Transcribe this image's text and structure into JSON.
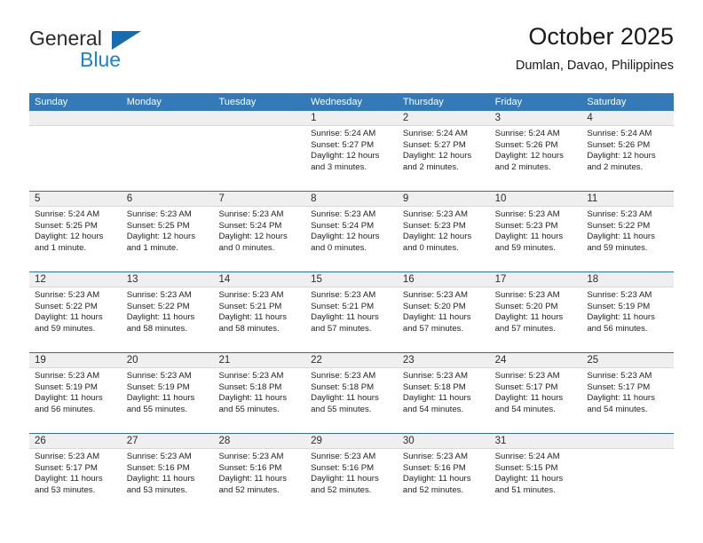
{
  "brand": {
    "name_part1": "General",
    "name_part2": "Blue",
    "accent_color": "#176bb1",
    "blue_text_color": "#1d81d0"
  },
  "header": {
    "title": "October 2025",
    "subtitle": "Dumlan, Davao, Philippines"
  },
  "calendar": {
    "header_color": "#3479b8",
    "day_strip_color": "#efefef",
    "weekdays": [
      "Sunday",
      "Monday",
      "Tuesday",
      "Wednesday",
      "Thursday",
      "Friday",
      "Saturday"
    ],
    "weeks": [
      [
        {
          "day": "",
          "empty": true
        },
        {
          "day": "",
          "empty": true
        },
        {
          "day": "",
          "empty": true
        },
        {
          "day": "1",
          "sunrise": "Sunrise: 5:24 AM",
          "sunset": "Sunset: 5:27 PM",
          "daylight_1": "Daylight: 12 hours",
          "daylight_2": "and 3 minutes."
        },
        {
          "day": "2",
          "sunrise": "Sunrise: 5:24 AM",
          "sunset": "Sunset: 5:27 PM",
          "daylight_1": "Daylight: 12 hours",
          "daylight_2": "and 2 minutes."
        },
        {
          "day": "3",
          "sunrise": "Sunrise: 5:24 AM",
          "sunset": "Sunset: 5:26 PM",
          "daylight_1": "Daylight: 12 hours",
          "daylight_2": "and 2 minutes."
        },
        {
          "day": "4",
          "sunrise": "Sunrise: 5:24 AM",
          "sunset": "Sunset: 5:26 PM",
          "daylight_1": "Daylight: 12 hours",
          "daylight_2": "and 2 minutes."
        }
      ],
      [
        {
          "day": "5",
          "sunrise": "Sunrise: 5:24 AM",
          "sunset": "Sunset: 5:25 PM",
          "daylight_1": "Daylight: 12 hours",
          "daylight_2": "and 1 minute."
        },
        {
          "day": "6",
          "sunrise": "Sunrise: 5:23 AM",
          "sunset": "Sunset: 5:25 PM",
          "daylight_1": "Daylight: 12 hours",
          "daylight_2": "and 1 minute."
        },
        {
          "day": "7",
          "sunrise": "Sunrise: 5:23 AM",
          "sunset": "Sunset: 5:24 PM",
          "daylight_1": "Daylight: 12 hours",
          "daylight_2": "and 0 minutes."
        },
        {
          "day": "8",
          "sunrise": "Sunrise: 5:23 AM",
          "sunset": "Sunset: 5:24 PM",
          "daylight_1": "Daylight: 12 hours",
          "daylight_2": "and 0 minutes."
        },
        {
          "day": "9",
          "sunrise": "Sunrise: 5:23 AM",
          "sunset": "Sunset: 5:23 PM",
          "daylight_1": "Daylight: 12 hours",
          "daylight_2": "and 0 minutes."
        },
        {
          "day": "10",
          "sunrise": "Sunrise: 5:23 AM",
          "sunset": "Sunset: 5:23 PM",
          "daylight_1": "Daylight: 11 hours",
          "daylight_2": "and 59 minutes."
        },
        {
          "day": "11",
          "sunrise": "Sunrise: 5:23 AM",
          "sunset": "Sunset: 5:22 PM",
          "daylight_1": "Daylight: 11 hours",
          "daylight_2": "and 59 minutes."
        }
      ],
      [
        {
          "day": "12",
          "sunrise": "Sunrise: 5:23 AM",
          "sunset": "Sunset: 5:22 PM",
          "daylight_1": "Daylight: 11 hours",
          "daylight_2": "and 59 minutes."
        },
        {
          "day": "13",
          "sunrise": "Sunrise: 5:23 AM",
          "sunset": "Sunset: 5:22 PM",
          "daylight_1": "Daylight: 11 hours",
          "daylight_2": "and 58 minutes."
        },
        {
          "day": "14",
          "sunrise": "Sunrise: 5:23 AM",
          "sunset": "Sunset: 5:21 PM",
          "daylight_1": "Daylight: 11 hours",
          "daylight_2": "and 58 minutes."
        },
        {
          "day": "15",
          "sunrise": "Sunrise: 5:23 AM",
          "sunset": "Sunset: 5:21 PM",
          "daylight_1": "Daylight: 11 hours",
          "daylight_2": "and 57 minutes."
        },
        {
          "day": "16",
          "sunrise": "Sunrise: 5:23 AM",
          "sunset": "Sunset: 5:20 PM",
          "daylight_1": "Daylight: 11 hours",
          "daylight_2": "and 57 minutes."
        },
        {
          "day": "17",
          "sunrise": "Sunrise: 5:23 AM",
          "sunset": "Sunset: 5:20 PM",
          "daylight_1": "Daylight: 11 hours",
          "daylight_2": "and 57 minutes."
        },
        {
          "day": "18",
          "sunrise": "Sunrise: 5:23 AM",
          "sunset": "Sunset: 5:19 PM",
          "daylight_1": "Daylight: 11 hours",
          "daylight_2": "and 56 minutes."
        }
      ],
      [
        {
          "day": "19",
          "sunrise": "Sunrise: 5:23 AM",
          "sunset": "Sunset: 5:19 PM",
          "daylight_1": "Daylight: 11 hours",
          "daylight_2": "and 56 minutes."
        },
        {
          "day": "20",
          "sunrise": "Sunrise: 5:23 AM",
          "sunset": "Sunset: 5:19 PM",
          "daylight_1": "Daylight: 11 hours",
          "daylight_2": "and 55 minutes."
        },
        {
          "day": "21",
          "sunrise": "Sunrise: 5:23 AM",
          "sunset": "Sunset: 5:18 PM",
          "daylight_1": "Daylight: 11 hours",
          "daylight_2": "and 55 minutes."
        },
        {
          "day": "22",
          "sunrise": "Sunrise: 5:23 AM",
          "sunset": "Sunset: 5:18 PM",
          "daylight_1": "Daylight: 11 hours",
          "daylight_2": "and 55 minutes."
        },
        {
          "day": "23",
          "sunrise": "Sunrise: 5:23 AM",
          "sunset": "Sunset: 5:18 PM",
          "daylight_1": "Daylight: 11 hours",
          "daylight_2": "and 54 minutes."
        },
        {
          "day": "24",
          "sunrise": "Sunrise: 5:23 AM",
          "sunset": "Sunset: 5:17 PM",
          "daylight_1": "Daylight: 11 hours",
          "daylight_2": "and 54 minutes."
        },
        {
          "day": "25",
          "sunrise": "Sunrise: 5:23 AM",
          "sunset": "Sunset: 5:17 PM",
          "daylight_1": "Daylight: 11 hours",
          "daylight_2": "and 54 minutes."
        }
      ],
      [
        {
          "day": "26",
          "sunrise": "Sunrise: 5:23 AM",
          "sunset": "Sunset: 5:17 PM",
          "daylight_1": "Daylight: 11 hours",
          "daylight_2": "and 53 minutes."
        },
        {
          "day": "27",
          "sunrise": "Sunrise: 5:23 AM",
          "sunset": "Sunset: 5:16 PM",
          "daylight_1": "Daylight: 11 hours",
          "daylight_2": "and 53 minutes."
        },
        {
          "day": "28",
          "sunrise": "Sunrise: 5:23 AM",
          "sunset": "Sunset: 5:16 PM",
          "daylight_1": "Daylight: 11 hours",
          "daylight_2": "and 52 minutes."
        },
        {
          "day": "29",
          "sunrise": "Sunrise: 5:23 AM",
          "sunset": "Sunset: 5:16 PM",
          "daylight_1": "Daylight: 11 hours",
          "daylight_2": "and 52 minutes."
        },
        {
          "day": "30",
          "sunrise": "Sunrise: 5:23 AM",
          "sunset": "Sunset: 5:16 PM",
          "daylight_1": "Daylight: 11 hours",
          "daylight_2": "and 52 minutes."
        },
        {
          "day": "31",
          "sunrise": "Sunrise: 5:24 AM",
          "sunset": "Sunset: 5:15 PM",
          "daylight_1": "Daylight: 11 hours",
          "daylight_2": "and 51 minutes."
        },
        {
          "day": "",
          "empty": true
        }
      ]
    ]
  }
}
